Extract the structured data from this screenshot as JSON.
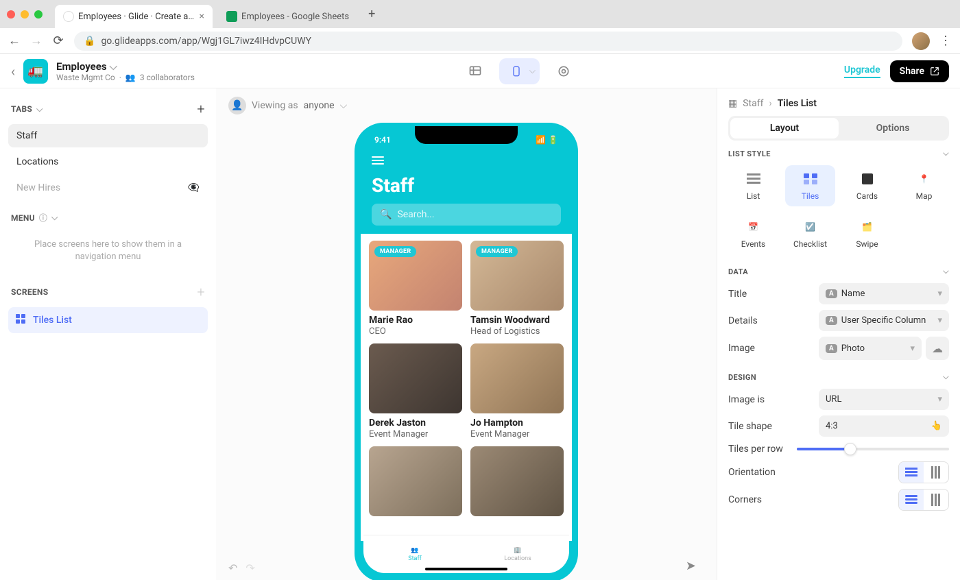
{
  "browser": {
    "tabs": [
      {
        "title": "Employees · Glide · Create apps",
        "favicon_bg": "#fff"
      },
      {
        "title": "Employees - Google Sheets",
        "favicon_bg": "#0f9d58"
      }
    ],
    "url": "go.glideapps.com/app/Wgj1GL7iwz4IHdvpCUWY"
  },
  "app_header": {
    "title": "Employees",
    "org": "Waste Mgmt Co",
    "collaborators": "3 collaborators",
    "upgrade": "Upgrade",
    "share": "Share"
  },
  "left": {
    "tabs_label": "TABS",
    "tabs": [
      {
        "label": "Staff",
        "active": true
      },
      {
        "label": "Locations"
      },
      {
        "label": "New Hires",
        "muted": true
      }
    ],
    "menu_label": "MENU",
    "menu_placeholder": "Place screens here to show them in a navigation menu",
    "screens_label": "SCREENS",
    "screens": [
      {
        "label": "Tiles List",
        "active": true
      }
    ]
  },
  "canvas": {
    "viewing_as_label": "Viewing as",
    "viewing_as_value": "anyone"
  },
  "phone": {
    "time": "9:41",
    "title": "Staff",
    "search_placeholder": "Search...",
    "tiles": [
      {
        "name": "Marie Rao",
        "role": "CEO",
        "badge": "MANAGER"
      },
      {
        "name": "Tamsin Woodward",
        "role": "Head of Logistics",
        "badge": "MANAGER"
      },
      {
        "name": "Derek Jaston",
        "role": "Event Manager"
      },
      {
        "name": "Jo Hampton",
        "role": "Event Manager"
      }
    ],
    "tabbar": [
      {
        "label": "Staff",
        "active": true
      },
      {
        "label": "Locations"
      }
    ]
  },
  "right": {
    "breadcrumb_parent": "Staff",
    "breadcrumb_current": "Tiles List",
    "seg": {
      "layout": "Layout",
      "options": "Options"
    },
    "list_style_label": "LIST STYLE",
    "list_styles": [
      "List",
      "Tiles",
      "Cards",
      "Map",
      "Events",
      "Checklist",
      "Swipe"
    ],
    "data_label": "DATA",
    "data_rows": {
      "title": {
        "label": "Title",
        "value": "Name"
      },
      "details": {
        "label": "Details",
        "value": "User Specific Column"
      },
      "image": {
        "label": "Image",
        "value": "Photo"
      }
    },
    "design_label": "DESIGN",
    "design_rows": {
      "image_is": {
        "label": "Image is",
        "value": "URL"
      },
      "tile_shape": {
        "label": "Tile shape",
        "value": "4:3"
      },
      "tiles_per_row": {
        "label": "Tiles per row"
      },
      "orientation": {
        "label": "Orientation"
      },
      "corners": {
        "label": "Corners"
      }
    }
  }
}
